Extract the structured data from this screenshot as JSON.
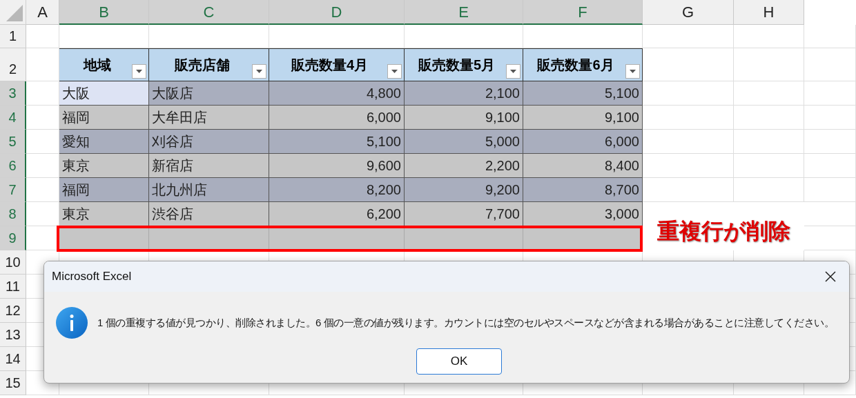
{
  "column_headers": [
    {
      "label": "A",
      "selected": false
    },
    {
      "label": "B",
      "selected": true
    },
    {
      "label": "C",
      "selected": true
    },
    {
      "label": "D",
      "selected": true
    },
    {
      "label": "E",
      "selected": true
    },
    {
      "label": "F",
      "selected": true
    },
    {
      "label": "G",
      "selected": false
    },
    {
      "label": "H",
      "selected": false
    }
  ],
  "row_headers": [
    {
      "label": "1",
      "selected": false
    },
    {
      "label": "2",
      "selected": false
    },
    {
      "label": "3",
      "selected": true
    },
    {
      "label": "4",
      "selected": true
    },
    {
      "label": "5",
      "selected": true
    },
    {
      "label": "6",
      "selected": true
    },
    {
      "label": "7",
      "selected": true
    },
    {
      "label": "8",
      "selected": true
    },
    {
      "label": "9",
      "selected": true
    },
    {
      "label": "10",
      "selected": false
    },
    {
      "label": "11",
      "selected": false
    },
    {
      "label": "12",
      "selected": false
    },
    {
      "label": "13",
      "selected": false
    },
    {
      "label": "14",
      "selected": false
    },
    {
      "label": "15",
      "selected": false
    }
  ],
  "table": {
    "columns": [
      {
        "label": "地域",
        "kind": "text"
      },
      {
        "label": "販売店舗",
        "kind": "text"
      },
      {
        "label": "販売数量4月",
        "kind": "number"
      },
      {
        "label": "販売数量5月",
        "kind": "number"
      },
      {
        "label": "販売数量6月",
        "kind": "number"
      }
    ],
    "rows": [
      {
        "cells": [
          {
            "text": "大阪",
            "selected": true
          },
          {
            "text": "大阪店",
            "selected": false
          },
          {
            "text": "4,800",
            "selected": false
          },
          {
            "text": "2,100",
            "selected": false
          },
          {
            "text": "5,100",
            "selected": false
          }
        ]
      },
      {
        "cells": [
          {
            "text": "福岡",
            "selected": false
          },
          {
            "text": "大牟田店",
            "selected": false
          },
          {
            "text": "6,000",
            "selected": false
          },
          {
            "text": "9,100",
            "selected": false
          },
          {
            "text": "9,100",
            "selected": false
          }
        ]
      },
      {
        "cells": [
          {
            "text": "愛知",
            "selected": false
          },
          {
            "text": "刈谷店",
            "selected": false
          },
          {
            "text": "5,100",
            "selected": false
          },
          {
            "text": "5,000",
            "selected": false
          },
          {
            "text": "6,000",
            "selected": false
          }
        ]
      },
      {
        "cells": [
          {
            "text": "東京",
            "selected": false
          },
          {
            "text": "新宿店",
            "selected": false
          },
          {
            "text": "9,600",
            "selected": false
          },
          {
            "text": "2,200",
            "selected": false
          },
          {
            "text": "8,400",
            "selected": false
          }
        ]
      },
      {
        "cells": [
          {
            "text": "福岡",
            "selected": false
          },
          {
            "text": "北九州店",
            "selected": false
          },
          {
            "text": "8,200",
            "selected": false
          },
          {
            "text": "9,200",
            "selected": false
          },
          {
            "text": "8,700",
            "selected": false
          }
        ]
      },
      {
        "cells": [
          {
            "text": "東京",
            "selected": false
          },
          {
            "text": "渋谷店",
            "selected": false
          },
          {
            "text": "6,200",
            "selected": false
          },
          {
            "text": "7,700",
            "selected": false
          },
          {
            "text": "3,000",
            "selected": false
          }
        ]
      }
    ]
  },
  "annotation": {
    "label": "重複行が削除"
  },
  "dialog": {
    "title": "Microsoft Excel",
    "message": "1 個の重複する値が見つかり、削除されました。6 個の一意の値が残ります。カウントには空のセルやスペースなどが含まれる場合があることに注意してください。",
    "buttons": [
      "OK"
    ]
  }
}
